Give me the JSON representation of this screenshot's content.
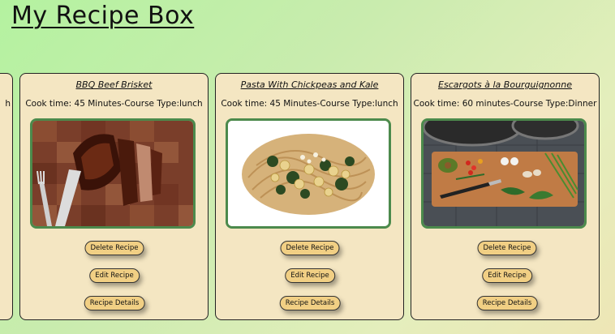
{
  "app": {
    "title": "My Recipe Box"
  },
  "partial_card": {
    "meta_fragment": "h"
  },
  "recipes": [
    {
      "name": "BBQ Beef Brisket",
      "meta": "Cook time: 45 Minutes-Course Type:lunch",
      "image": "beef-brisket-image"
    },
    {
      "name": "Pasta With Chickpeas and Kale",
      "meta": "Cook time: 45 Minutes-Course Type:lunch",
      "image": "pasta-image"
    },
    {
      "name": "Escargots à la Bourguignonne",
      "meta": "Cook time: 60 minutes-Course Type:Dinner",
      "image": "vegetables-board-image"
    }
  ],
  "buttons": {
    "delete": "Delete Recipe",
    "edit": "Edit Recipe",
    "details": "Recipe Details"
  }
}
